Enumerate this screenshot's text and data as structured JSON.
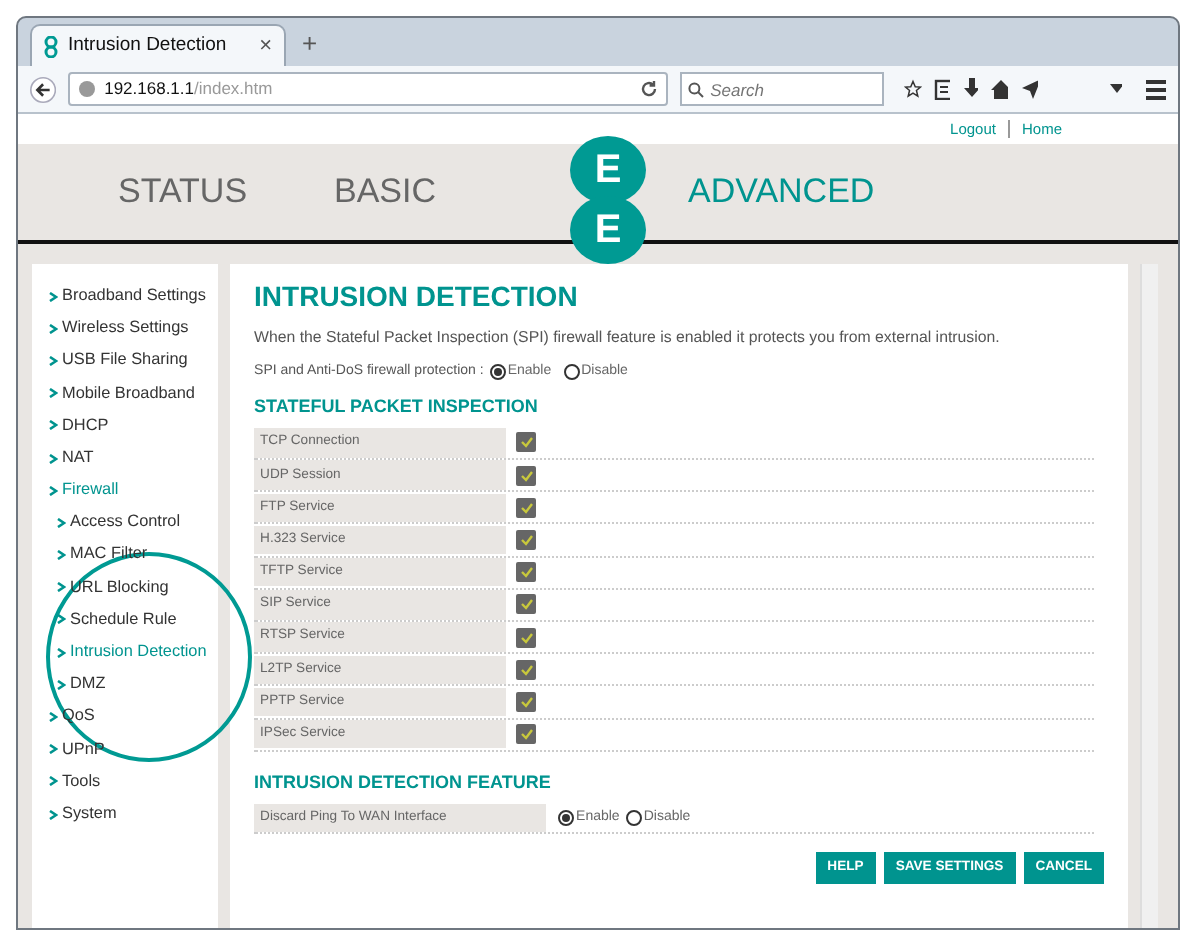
{
  "browser": {
    "tab_title": "Intrusion Detection",
    "new_tab": "+",
    "tab_close": "×",
    "url_host": "192.168.1.1",
    "url_path": "/index.htm",
    "search": {
      "placeholder": "Search"
    }
  },
  "top_links": [
    "Logout",
    "Home"
  ],
  "nav": [
    {
      "label": "STATUS",
      "selected": false
    },
    {
      "label": "BASIC",
      "selected": false
    },
    {
      "label": "ADVANCED",
      "selected": true
    }
  ],
  "logo": [
    "E",
    "E"
  ],
  "sidebar": {
    "items": [
      {
        "label": "Broadband Settings",
        "selected": false
      },
      {
        "label": "Wireless Settings",
        "selected": false
      },
      {
        "label": "USB File Sharing",
        "selected": false
      },
      {
        "label": "Mobile Broadband",
        "selected": false
      },
      {
        "label": "DHCP",
        "selected": false
      },
      {
        "label": "NAT",
        "selected": false
      },
      {
        "label": "Firewall",
        "selected": true,
        "children": [
          {
            "label": "Access Control",
            "selected": false
          },
          {
            "label": "MAC Filter",
            "selected": false
          },
          {
            "label": "URL Blocking",
            "selected": false
          },
          {
            "label": "Schedule Rule",
            "selected": false
          },
          {
            "label": "Intrusion Detection",
            "selected": true
          },
          {
            "label": "DMZ",
            "selected": false
          }
        ]
      },
      {
        "label": "QoS",
        "selected": false
      },
      {
        "label": "UPnP",
        "selected": false
      },
      {
        "label": "Tools",
        "selected": false
      },
      {
        "label": "System",
        "selected": false
      }
    ]
  },
  "page_title": "INTRUSION DETECTION",
  "intro": "When the Stateful Packet Inspection (SPI) firewall feature is enabled it protects you from external intrusion.",
  "spi": {
    "label": "SPI and Anti-DoS firewall protection :",
    "options": [
      {
        "label": "Enable",
        "selected": true
      },
      {
        "label": "Disable",
        "selected": false
      }
    ]
  },
  "spi_section": {
    "title": "STATEFUL PACKET INSPECTION",
    "rows": [
      {
        "label": "TCP Connection",
        "checked": true
      },
      {
        "label": "UDP Session",
        "checked": true
      },
      {
        "label": "FTP Service",
        "checked": true
      },
      {
        "label": "H.323 Service",
        "checked": true
      },
      {
        "label": "TFTP Service",
        "checked": true
      },
      {
        "label": "SIP Service",
        "checked": true
      },
      {
        "label": "RTSP Service",
        "checked": true
      },
      {
        "label": "L2TP Service",
        "checked": true
      },
      {
        "label": "PPTP Service",
        "checked": true
      },
      {
        "label": "IPSec Service",
        "checked": true
      }
    ]
  },
  "feature_section": {
    "title": "INTRUSION DETECTION FEATURE",
    "rows": [
      {
        "label": "Discard Ping To WAN Interface",
        "options": [
          {
            "label": "Enable",
            "selected": true
          },
          {
            "label": "Disable",
            "selected": false
          }
        ]
      }
    ]
  },
  "buttons": [
    "HELP",
    "SAVE SETTINGS",
    "CANCEL"
  ]
}
